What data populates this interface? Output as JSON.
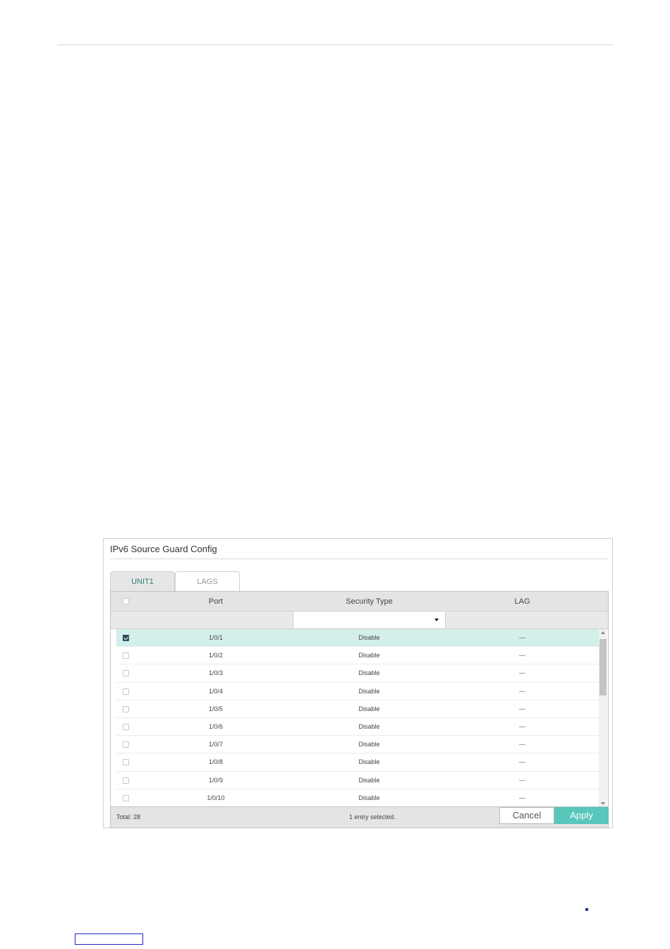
{
  "panel": {
    "title": "IPv6 Source Guard Config"
  },
  "tabs": [
    {
      "label": "UNIT1",
      "active": true
    },
    {
      "label": "LAGS",
      "active": false
    }
  ],
  "table": {
    "columns": {
      "select": "",
      "port": "Port",
      "security_type": "Security Type",
      "lag": "LAG"
    },
    "filter": {
      "security_type_value": ""
    },
    "rows": [
      {
        "checked": true,
        "port": "1/0/1",
        "security_type": "Disable",
        "lag": "---"
      },
      {
        "checked": false,
        "port": "1/0/2",
        "security_type": "Disable",
        "lag": "---"
      },
      {
        "checked": false,
        "port": "1/0/3",
        "security_type": "Disable",
        "lag": "---"
      },
      {
        "checked": false,
        "port": "1/0/4",
        "security_type": "Disable",
        "lag": "---"
      },
      {
        "checked": false,
        "port": "1/0/5",
        "security_type": "Disable",
        "lag": "---"
      },
      {
        "checked": false,
        "port": "1/0/6",
        "security_type": "Disable",
        "lag": "---"
      },
      {
        "checked": false,
        "port": "1/0/7",
        "security_type": "Disable",
        "lag": "---"
      },
      {
        "checked": false,
        "port": "1/0/8",
        "security_type": "Disable",
        "lag": "---"
      },
      {
        "checked": false,
        "port": "1/0/9",
        "security_type": "Disable",
        "lag": "---"
      },
      {
        "checked": false,
        "port": "1/0/10",
        "security_type": "Disable",
        "lag": "---"
      }
    ]
  },
  "footer": {
    "total": "Total: 28",
    "selection": "1 entry selected.",
    "cancel_label": "Cancel",
    "apply_label": "Apply"
  },
  "colors": {
    "accent": "#58c6bb",
    "selected_row": "#d3efe9",
    "active_tab_text": "#2f7f77"
  }
}
